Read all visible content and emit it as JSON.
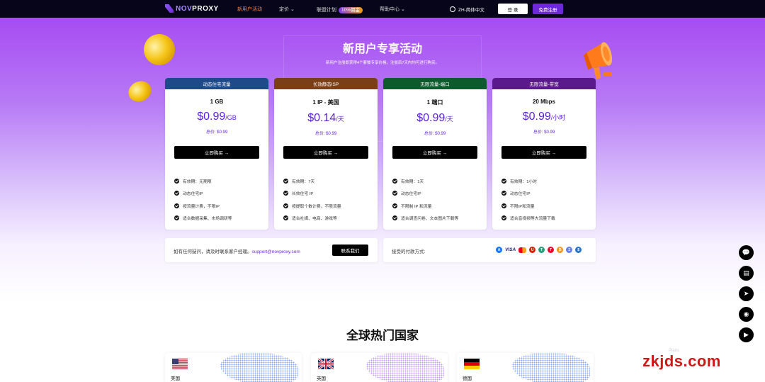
{
  "nav": {
    "logo": "NOVPROXY",
    "logo_prefix": "NOV",
    "logo_suffix": "PROXY",
    "links": [
      {
        "label": "新用户活动",
        "active": true
      },
      {
        "label": "定价"
      },
      {
        "label": "联盟计划",
        "badge": "10%佣金"
      },
      {
        "label": "帮助中心"
      }
    ],
    "language": "ZH-简体中文",
    "login": "登 录",
    "register": "免费注册"
  },
  "hero": {
    "title": "新用户专享活动",
    "subtitle": "新用户注册即获得4个套餐专享价格，注册后7天内均可进行购买。"
  },
  "plans": [
    {
      "header": "动态住宅流量",
      "header_color": "#1e4a8a",
      "amount": "1 GB",
      "price": "$0.99",
      "unit": "/GB",
      "total": "总价: $0.99",
      "buy": "立即购买 →",
      "features": [
        "有效期：无期限",
        "动态住宅IP",
        "按流量计费，不限IP",
        "适合数据采集、市场调研等"
      ]
    },
    {
      "header": "长效静态ISP",
      "header_color": "#7a3f17",
      "amount": "1 IP - 美国",
      "price": "$0.14",
      "unit": "/天",
      "total": "总价: $0.99",
      "buy": "立即购买 →",
      "features": [
        "有效期：7天",
        "长效住宅 IP",
        "按提取个数计费，不限流量",
        "适合社媒、电商、游戏等"
      ]
    },
    {
      "header": "无限流量-端口",
      "header_color": "#0d5a2c",
      "amount": "1 端口",
      "price": "$0.99",
      "unit": "/天",
      "total": "总价: $0.99",
      "buy": "立即购买 →",
      "features": [
        "有效期：1天",
        "动态住宅IP",
        "不限制 IP 和流量",
        "适合调查问卷、文本图片下载等"
      ]
    },
    {
      "header": "无限流量-带宽",
      "header_color": "#5b1a8c",
      "amount": "20 Mbps",
      "price": "$0.99",
      "unit": "/小时",
      "total": "总价: $0.99",
      "buy": "立即购买 →",
      "features": [
        "有效期：1小时",
        "动态住宅IP",
        "不限IP和流量",
        "适合音视频等大流量下载"
      ]
    }
  ],
  "contact": {
    "text": "如有任何疑问，请及时联系客户经理。",
    "email": "support@novproxy.com",
    "button": "联系我们"
  },
  "payment": {
    "label": "接受的付款方式:",
    "visa": "VISA",
    "methods": [
      {
        "icon": "alipay-icon",
        "color": "#1677ff",
        "glyph": "A"
      },
      {
        "icon": "mastercard-icon",
        "color": "#f79e1b",
        "glyph": ""
      },
      {
        "icon": "unionpay-icon",
        "color": "#d81e06",
        "glyph": "U"
      },
      {
        "icon": "tether-icon",
        "color": "#26a17b",
        "glyph": "T"
      },
      {
        "icon": "tron-icon",
        "color": "#eb0029",
        "glyph": "T"
      },
      {
        "icon": "bitcoin-icon",
        "color": "#f7931a",
        "glyph": "₿"
      },
      {
        "icon": "ethereum-icon",
        "color": "#627eea",
        "glyph": "Ξ"
      },
      {
        "icon": "usdc-icon",
        "color": "#2775ca",
        "glyph": "$"
      }
    ]
  },
  "section2": {
    "title": "全球热门国家",
    "countries": [
      "美国",
      "英国",
      "德国"
    ]
  },
  "floating": [
    "chat-icon",
    "message-icon",
    "telegram-icon",
    "discord-icon",
    "youtube-icon"
  ],
  "watermark": "zkjds.com",
  "watermark_small": "Plans"
}
